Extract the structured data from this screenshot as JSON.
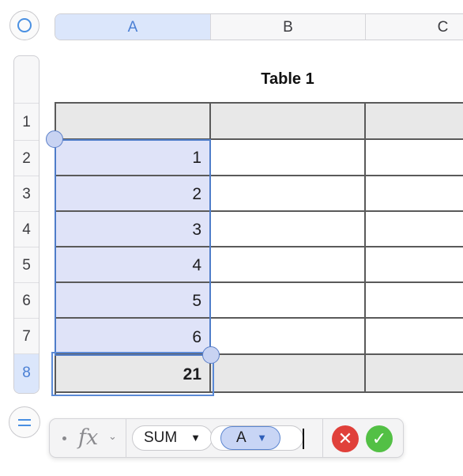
{
  "columns": [
    {
      "label": "A",
      "selected": true
    },
    {
      "label": "B",
      "selected": false
    },
    {
      "label": "C",
      "selected": false
    }
  ],
  "rows": [
    {
      "label": "1",
      "selected": false
    },
    {
      "label": "2",
      "selected": false
    },
    {
      "label": "3",
      "selected": false
    },
    {
      "label": "4",
      "selected": false
    },
    {
      "label": "5",
      "selected": false
    },
    {
      "label": "6",
      "selected": false
    },
    {
      "label": "7",
      "selected": false
    },
    {
      "label": "8",
      "selected": true
    }
  ],
  "table": {
    "title": "Table 1",
    "values": [
      "1",
      "2",
      "3",
      "4",
      "5",
      "6"
    ],
    "footer_value": "21"
  },
  "formula": {
    "fx_label": "fx",
    "function": "SUM",
    "argument": "A"
  },
  "icons": {
    "select_all": "circle-icon",
    "formula_toggle": "equals-icon",
    "cancel": "x-icon",
    "confirm": "checkmark-icon"
  },
  "colors": {
    "accent": "#4a90e2",
    "selection_fill": "#dfe3f8",
    "cancel": "#e0403a",
    "confirm": "#53c045"
  }
}
